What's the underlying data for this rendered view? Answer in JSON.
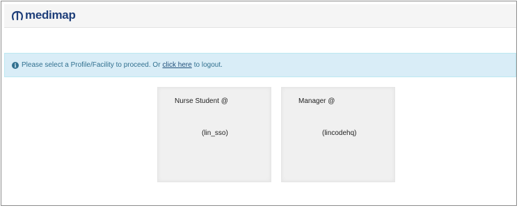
{
  "brand": {
    "logo_text": "medimap",
    "color": "#1f3f7a"
  },
  "alert": {
    "icon": "info-circle-icon",
    "text_before": "Please select a Profile/Facility to proceed. Or",
    "link_text": "click here",
    "text_after": "to logout.",
    "background": "#d9edf7"
  },
  "profiles": [
    {
      "role": "Nurse Student @",
      "facility": "(lin_sso)"
    },
    {
      "role": "Manager @",
      "facility": "(lincodehq)"
    }
  ]
}
